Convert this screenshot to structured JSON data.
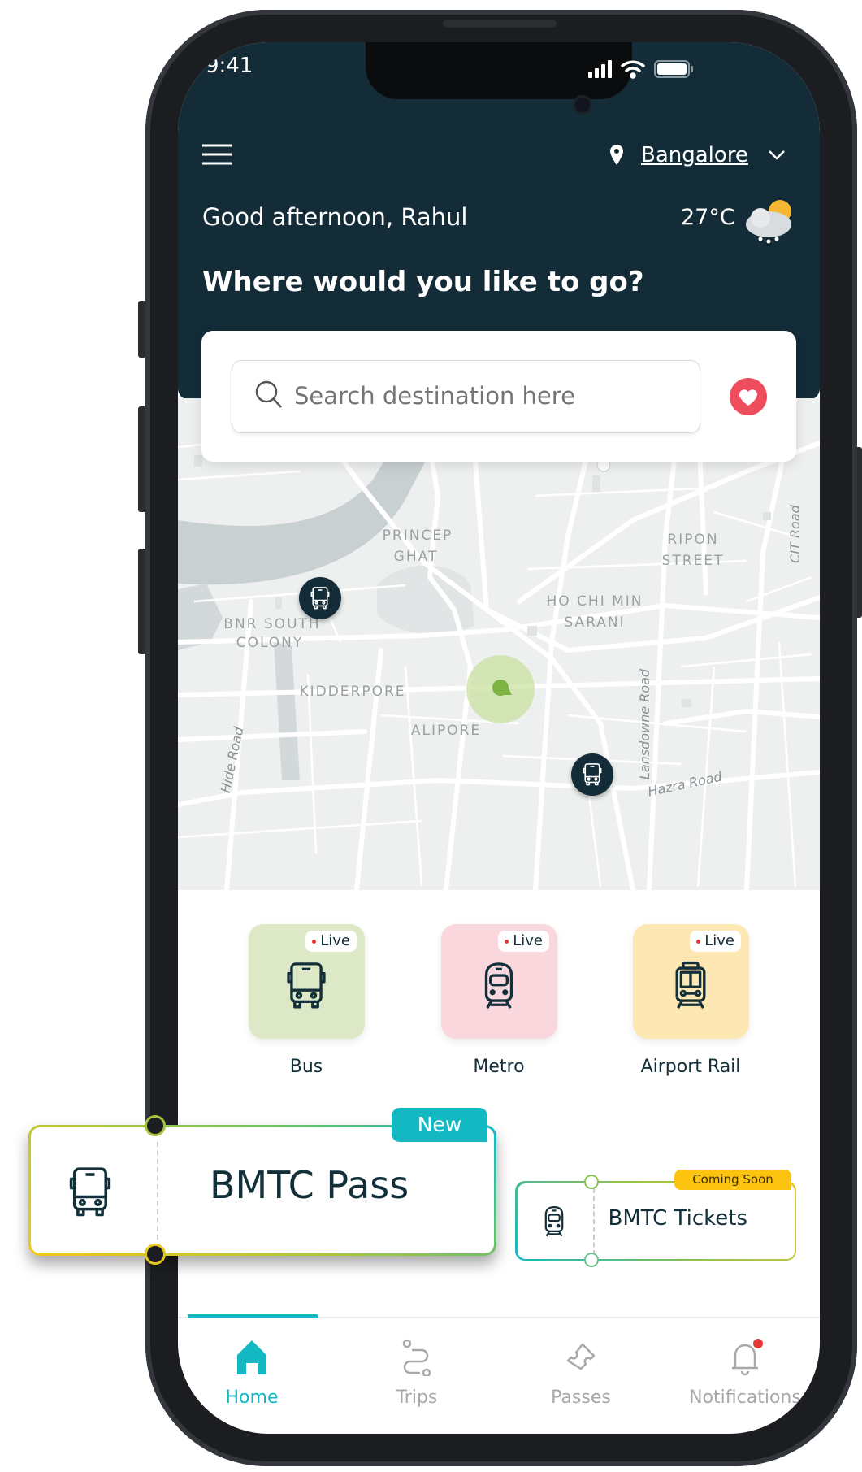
{
  "status_bar": {
    "time": "9:41"
  },
  "header": {
    "location": "Bangalore",
    "greeting": "Good afternoon, Rahul",
    "temperature": "27°C",
    "weather_icon": "cloud-rain-sun-icon",
    "prompt": "Where would you like to go?"
  },
  "search": {
    "placeholder": "Search destination here",
    "value": ""
  },
  "map": {
    "labels": {
      "princep": "PRINCEP",
      "ghat": "GHAT",
      "ripon": "RIPON",
      "street": "STREET",
      "cit_road": "CIT Road",
      "hochimin": "HO CHI MIN",
      "sarani": "SARANI",
      "bnr": "BNR SOUTH",
      "colony": "COLONY",
      "kidderpore": "KIDDERPORE",
      "alipore": "ALIPORE",
      "hide_road": "Hide Road",
      "lansdowne_road": "Lansdowne Road",
      "hazra_road": "Hazra Road"
    }
  },
  "modes": [
    {
      "label": "Bus",
      "badge": "Live",
      "color": "#dde9c6",
      "icon": "bus-icon"
    },
    {
      "label": "Metro",
      "badge": "Live",
      "color": "#f9d7dc",
      "icon": "metro-icon"
    },
    {
      "label": "Airport Rail",
      "badge": "Live",
      "color": "#fde8b4",
      "icon": "train-icon"
    }
  ],
  "pass_card": {
    "title": "BMTC Pass",
    "badge": "New",
    "badge_color": "#13b8c2"
  },
  "tickets_card": {
    "title": "BMTC Tickets",
    "badge": "Coming Soon",
    "badge_color": "#fcc310"
  },
  "nav": {
    "items": [
      {
        "label": "Home",
        "icon": "home-icon",
        "active": true
      },
      {
        "label": "Trips",
        "icon": "route-icon",
        "active": false
      },
      {
        "label": "Passes",
        "icon": "ticket-icon",
        "active": false
      },
      {
        "label": "Notifications",
        "icon": "bell-icon",
        "active": false,
        "has_badge": true
      }
    ],
    "accent": "#13b8c2"
  }
}
